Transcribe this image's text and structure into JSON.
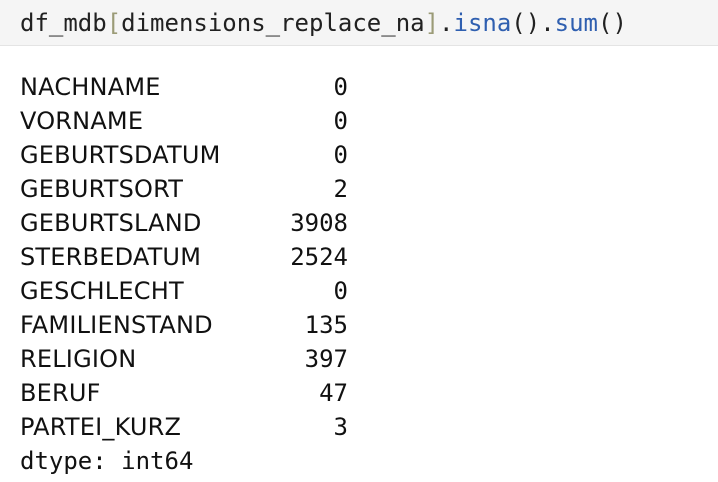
{
  "input": {
    "code_prefix": "df_mdb",
    "open_bracket": "[",
    "argument": "dimensions_replace_na",
    "close_bracket": "]",
    "dot1": ".",
    "method1": "isna",
    "parens1": "()",
    "dot2": ".",
    "method2": "sum",
    "parens2": "()"
  },
  "output": {
    "rows": [
      {
        "name": "NACHNAME",
        "value": "0"
      },
      {
        "name": "VORNAME",
        "value": "0"
      },
      {
        "name": "GEBURTSDATUM",
        "value": "0"
      },
      {
        "name": "GEBURTSORT",
        "value": "2"
      },
      {
        "name": "GEBURTSLAND",
        "value": "3908"
      },
      {
        "name": "STERBEDATUM",
        "value": "2524"
      },
      {
        "name": "GESCHLECHT",
        "value": "0"
      },
      {
        "name": "FAMILIENSTAND",
        "value": "135"
      },
      {
        "name": "RELIGION",
        "value": "397"
      },
      {
        "name": "BERUF",
        "value": "47"
      },
      {
        "name": "PARTEI_KURZ",
        "value": "3"
      }
    ],
    "dtype": "dtype: int64"
  }
}
